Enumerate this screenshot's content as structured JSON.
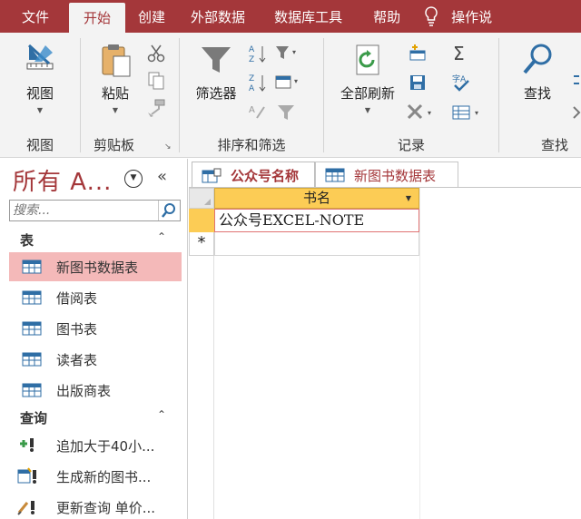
{
  "menu": {
    "tabs": [
      "文件",
      "开始",
      "创建",
      "外部数据",
      "数据库工具",
      "帮助"
    ],
    "active_index": 1,
    "tell_me": "操作说"
  },
  "ribbon": {
    "groups": {
      "views": {
        "label": "视图",
        "btn": "视图"
      },
      "clipboard": {
        "label": "剪贴板",
        "btn": "粘贴"
      },
      "sort_filter": {
        "label": "排序和筛选",
        "btn": "筛选器"
      },
      "records": {
        "label": "记录",
        "btn": "全部刷新"
      },
      "find": {
        "label": "查找",
        "btn": "查找"
      }
    }
  },
  "nav": {
    "title": "所有 A...",
    "search_placeholder": "搜索...",
    "sections": [
      {
        "name": "表",
        "items": [
          "新图书数据表",
          "借阅表",
          "图书表",
          "读者表",
          "出版商表"
        ]
      },
      {
        "name": "查询",
        "items": [
          "追加大于40小...",
          "生成新的图书...",
          "更新查询 单价..."
        ]
      }
    ],
    "selected_item": "新图书数据表"
  },
  "doc_tabs": [
    {
      "label": "公众号名称",
      "active": true
    },
    {
      "label": "新图书数据表",
      "active": false
    }
  ],
  "datasheet": {
    "column": "书名",
    "rows": [
      "公众号EXCEL-NOTE"
    ],
    "new_row_marker": "*"
  },
  "colors": {
    "accent": "#a4373a",
    "selection": "#fccc55",
    "nav_selected": "#f4b9b9"
  }
}
